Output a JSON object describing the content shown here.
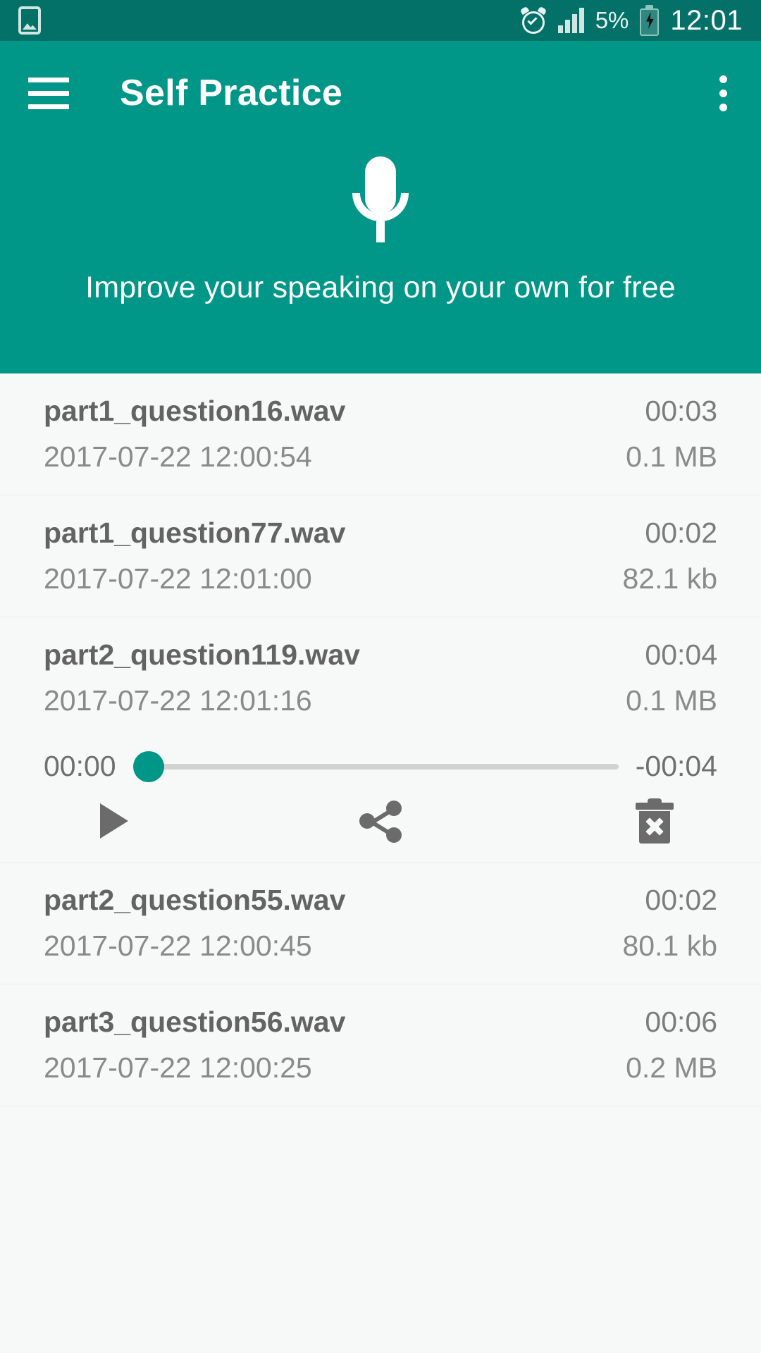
{
  "status_bar": {
    "photo_icon": "image-icon",
    "alarm_icon": "alarm-clock-icon",
    "signal_icon": "signal-bars-icon",
    "battery_percent": "5%",
    "battery_icon": "battery-charging-icon",
    "clock": "12:01"
  },
  "app_bar": {
    "menu_icon": "hamburger-menu-icon",
    "title": "Self Practice",
    "overflow_icon": "more-vertical-icon",
    "mic_icon": "microphone-icon",
    "tagline": "Improve your speaking on your own for free"
  },
  "colors": {
    "status_bar_bg": "#047169",
    "app_bar_bg": "#009688",
    "accent": "#009688",
    "list_bg": "#f7f8f8",
    "primary_text": "#636363",
    "secondary_text": "#8a8a8a",
    "icon_gray": "#6b6b6b",
    "track": "#d2d2d2"
  },
  "recordings": [
    {
      "name": "part1_question16.wav",
      "duration": "00:03",
      "date": "2017-07-22 12:00:54",
      "size": "0.1 MB",
      "expanded": false
    },
    {
      "name": "part1_question77.wav",
      "duration": "00:02",
      "date": "2017-07-22 12:01:00",
      "size": "82.1 kb",
      "expanded": false
    },
    {
      "name": "part2_question119.wav",
      "duration": "00:04",
      "date": "2017-07-22 12:01:16",
      "size": "0.1 MB",
      "expanded": true
    },
    {
      "name": "part2_question55.wav",
      "duration": "00:02",
      "date": "2017-07-22 12:00:45",
      "size": "80.1 kb",
      "expanded": false
    },
    {
      "name": "part3_question56.wav",
      "duration": "00:06",
      "date": "2017-07-22 12:00:25",
      "size": "0.2 MB",
      "expanded": false
    }
  ],
  "player": {
    "elapsed": "00:00",
    "remaining": "-00:04",
    "progress_percent": 0,
    "play_icon": "play-icon",
    "share_icon": "share-icon",
    "delete_icon": "delete-trash-icon"
  }
}
